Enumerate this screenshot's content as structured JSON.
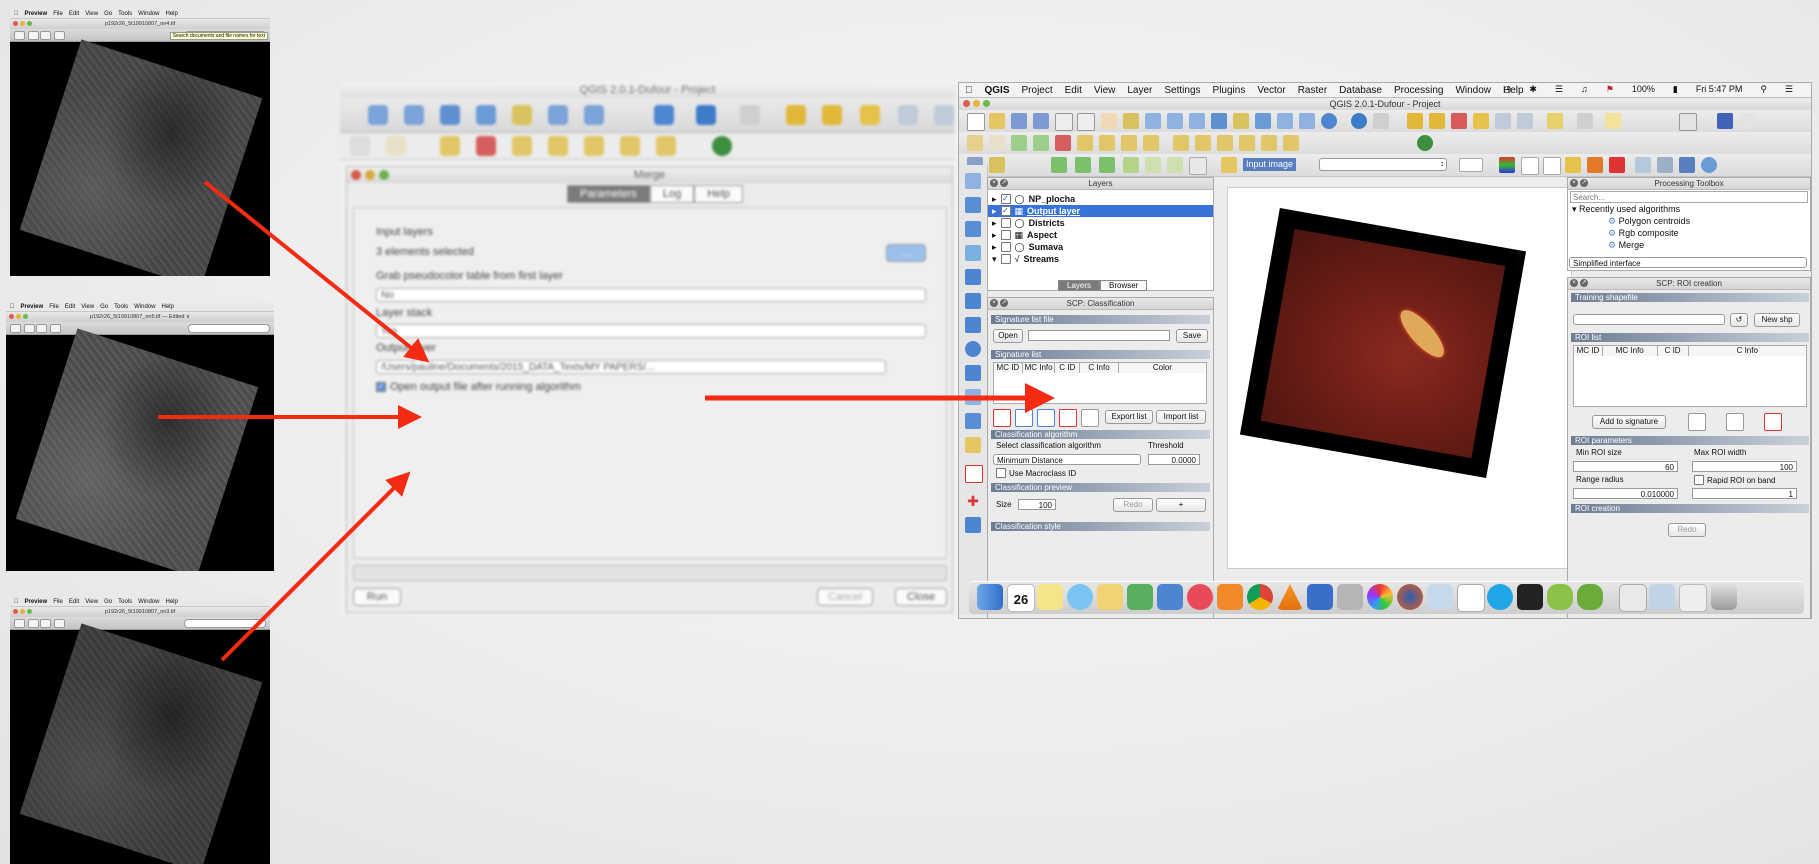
{
  "previews": [
    {
      "menu": [
        "Preview",
        "File",
        "Edit",
        "View",
        "Go",
        "Tools",
        "Window",
        "Help"
      ],
      "title": "p192r26_5t19910807_nn4.tif",
      "tooltip": "Search documents and file names for text"
    },
    {
      "menu": [
        "Preview",
        "File",
        "Edit",
        "View",
        "Go",
        "Tools",
        "Window",
        "Help"
      ],
      "title": "p192r26_5t19910807_nn5.tif — Edited ∨"
    },
    {
      "menu": [
        "Preview",
        "File",
        "Edit",
        "View",
        "Go",
        "Tools",
        "Window",
        "Help"
      ],
      "title": "p192r26_5t19910807_nn3.tif"
    }
  ],
  "merge_window": {
    "app_title": "QGIS 2.0.1-Dufour - Project",
    "dialog_title": "Merge",
    "tabs": [
      "Parameters",
      "Log",
      "Help"
    ],
    "input_layers_label": "Input layers",
    "input_layers_value": "3 elements selected",
    "browse_button": "...",
    "grab_label": "Grab pseudocolor table from first layer",
    "grab_value": "No",
    "layer_stack_label": "Layer stack",
    "layer_stack_value": "Yes",
    "output_label": "Output layer",
    "output_value": "/Users/pauline/Documents/2015_DATA_Texts/MY PAPERS/...",
    "open_output_label": "Open output file after running algorithm",
    "run": "Run",
    "cancel": "Cancel",
    "close": "Close"
  },
  "qgis": {
    "menubar": [
      "QGIS",
      "Project",
      "Edit",
      "View",
      "Layer",
      "Settings",
      "Plugins",
      "Vector",
      "Raster",
      "Database",
      "Processing",
      "Window",
      "Help"
    ],
    "status_right": {
      "battery": "100%",
      "clock": "Fri 5:47 PM"
    },
    "window_title": "QGIS 2.0.1-Dufour - Project",
    "input_image_label": "Input image",
    "layers_panel": {
      "title": "Layers",
      "rows": [
        {
          "name": "NP_plocha",
          "checked": true
        },
        {
          "name": "Output layer",
          "checked": true,
          "selected": true
        },
        {
          "name": "Districts",
          "checked": false
        },
        {
          "name": "Aspect",
          "checked": false
        },
        {
          "name": "Sumava",
          "checked": false
        },
        {
          "name": "Streams",
          "checked": false
        }
      ],
      "tabs": [
        "Layers",
        "Browser"
      ]
    },
    "scp_classification": {
      "title": "SCP: Classification",
      "sig_file_section": "Signature list file",
      "open": "Open",
      "save": "Save",
      "sig_list_section": "Signature list",
      "sig_columns": [
        "MC ID",
        "MC Info",
        "C ID",
        "C Info",
        "Color"
      ],
      "export_list": "Export list",
      "import_list": "Import list",
      "algorithm_section": "Classification algorithm",
      "select_algo_label": "Select classification algorithm",
      "threshold_label": "Threshold",
      "algorithm_value": "Minimum Distance",
      "threshold_value": "0.0000",
      "use_macroclass": "Use Macroclass ID",
      "preview_section": "Classification preview",
      "size_label": "Size",
      "size_value": "100",
      "redo": "Redo",
      "plus": "+",
      "style_section": "Classification style"
    },
    "processing_toolbox": {
      "title": "Processing Toolbox",
      "search_placeholder": "Search...",
      "recent_label": "Recently used algorithms",
      "items": [
        "Polygon centroids",
        "Rgb composite",
        "Merge"
      ],
      "interface_select": "Simplified interface"
    },
    "scp_roi": {
      "title": "SCP: ROI creation",
      "training_section": "Training shapefile",
      "new_shp": "New shp",
      "roi_list_section": "ROI list",
      "roi_columns": [
        "MC ID",
        "MC Info",
        "C ID",
        "C Info"
      ],
      "add_to_signature": "Add to signature",
      "roi_params_section": "ROI parameters",
      "min_roi_label": "Min ROI size",
      "min_roi_value": "60",
      "max_roi_label": "Max ROI width",
      "max_roi_value": "100",
      "range_radius_label": "Range radius",
      "range_radius_value": "0.010000",
      "rapid_roi_label": "Rapid ROI on band",
      "rapid_roi_value": "1",
      "roi_creation_section": "ROI creation",
      "redo": "Redo"
    },
    "dock_calendar_day": "26"
  }
}
